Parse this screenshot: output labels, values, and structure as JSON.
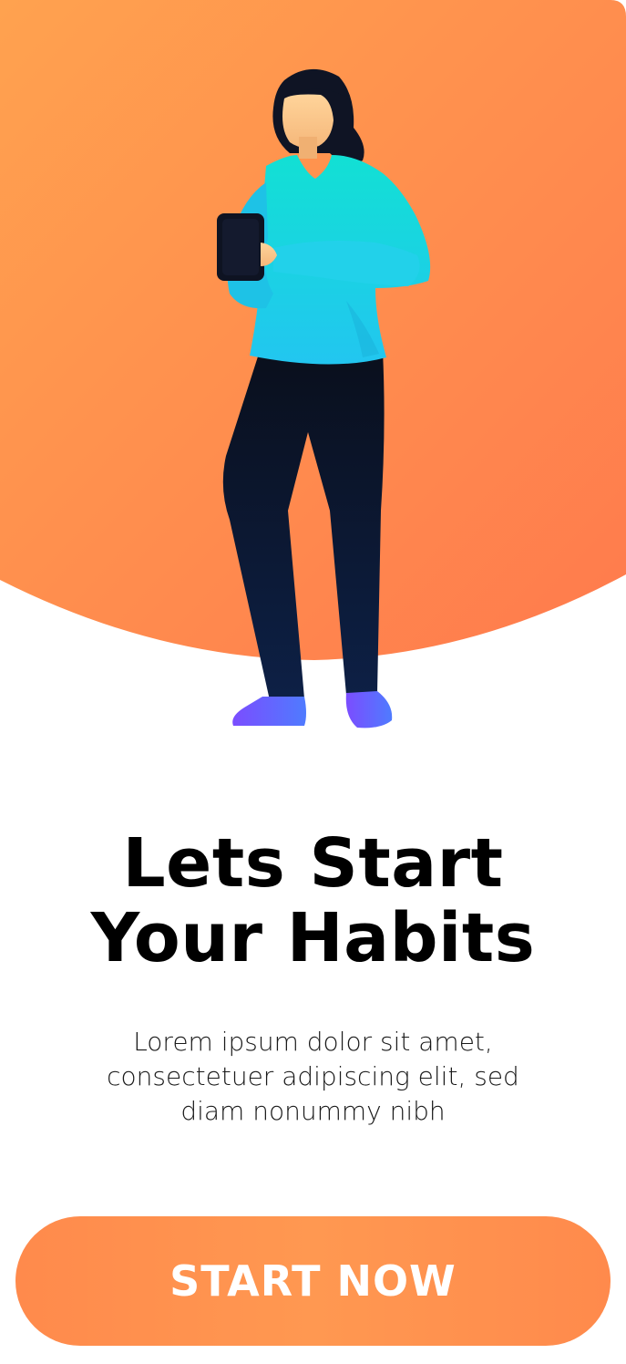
{
  "onboarding": {
    "title_line1": "Lets Start",
    "title_line2": "Your Habits",
    "description": "Lorem ipsum dolor sit amet, consectetuer adipiscing elit, sed diam nonummy nibh",
    "cta_label": "START NOW"
  },
  "colors": {
    "hero_gradient_start": "#ffa24f",
    "hero_gradient_end": "#ff7a4d",
    "button_gradient": "#ff8f4e",
    "shirt": "#1fd6e6",
    "pants": "#0b1a33",
    "shoes": "#6a5cff",
    "title_text": "#000000",
    "button_text": "#ffffff"
  },
  "illustration": {
    "subject": "woman-holding-phone"
  }
}
